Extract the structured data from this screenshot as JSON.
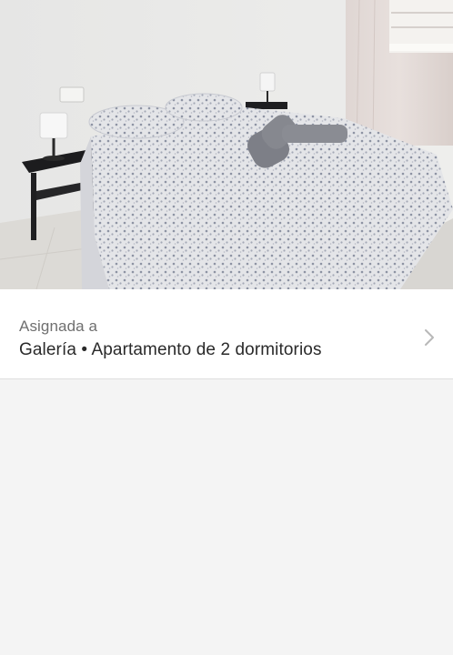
{
  "photo": {
    "subject": "bedroom-photo"
  },
  "assignment": {
    "label": "Asignada a",
    "value": "Galería • Apartamento de 2 dormitorios",
    "chevron_icon": "chevron-right-icon"
  }
}
